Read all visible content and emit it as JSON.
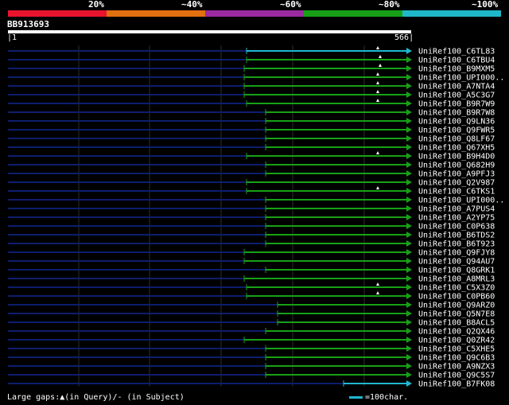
{
  "legend": {
    "segments": [
      {
        "color": "#e8142e",
        "label": "20%"
      },
      {
        "color": "#e07010",
        "label": "~40%"
      },
      {
        "color": "#9a2aa0",
        "label": "~60%"
      },
      {
        "color": "#17a017",
        "label": "~80%"
      },
      {
        "color": "#1fb8c8",
        "label": "~100%"
      }
    ]
  },
  "query": {
    "id": "BB913693",
    "start": "1",
    "end": "566",
    "length": 566
  },
  "hits": [
    {
      "label": "UniRef100_C6TL83",
      "start": 310,
      "color": "#1fb8d0",
      "gap": 475
    },
    {
      "label": "UniRef100_C6TBU4",
      "start": 310,
      "color": "#17a017",
      "gap": 478
    },
    {
      "label": "UniRef100_B9MXM5",
      "start": 307,
      "color": "#17a017",
      "gap": 478
    },
    {
      "label": "UniRef100_UPI000..",
      "start": 307,
      "color": "#17a017",
      "gap": 475
    },
    {
      "label": "UniRef100_A7NTA4",
      "start": 307,
      "color": "#17a017",
      "gap": 475
    },
    {
      "label": "UniRef100_A5C3G7",
      "start": 307,
      "color": "#17a017",
      "gap": 475
    },
    {
      "label": "UniRef100_B9R7W9",
      "start": 310,
      "color": "#17a017",
      "gap": 475
    },
    {
      "label": "UniRef100_B9R7W8",
      "start": 334,
      "color": "#17a017",
      "gap": null
    },
    {
      "label": "UniRef100_Q9LN36",
      "start": 334,
      "color": "#17a017",
      "gap": null
    },
    {
      "label": "UniRef100_Q9FWR5",
      "start": 334,
      "color": "#17a017",
      "gap": null
    },
    {
      "label": "UniRef100_Q8LF67",
      "start": 334,
      "color": "#17a017",
      "gap": null
    },
    {
      "label": "UniRef100_Q67XH5",
      "start": 334,
      "color": "#17a017",
      "gap": null
    },
    {
      "label": "UniRef100_B9H4D0",
      "start": 310,
      "color": "#17a017",
      "gap": 475
    },
    {
      "label": "UniRef100_Q682H9",
      "start": 334,
      "color": "#17a017",
      "gap": null
    },
    {
      "label": "UniRef100_A9PFJ3",
      "start": 334,
      "color": "#17a017",
      "gap": null
    },
    {
      "label": "UniRef100_Q2V987",
      "start": 310,
      "color": "#17a017",
      "gap": null
    },
    {
      "label": "UniRef100_C6TKS1",
      "start": 310,
      "color": "#17a017",
      "gap": 475
    },
    {
      "label": "UniRef100_UPI000..",
      "start": 334,
      "color": "#17a017",
      "gap": null
    },
    {
      "label": "UniRef100_A7PUS4",
      "start": 334,
      "color": "#17a017",
      "gap": null
    },
    {
      "label": "UniRef100_A2YP75",
      "start": 334,
      "color": "#17a017",
      "gap": null
    },
    {
      "label": "UniRef100_C0P638",
      "start": 334,
      "color": "#17a017",
      "gap": null
    },
    {
      "label": "UniRef100_B6TDS2",
      "start": 334,
      "color": "#17a017",
      "gap": null
    },
    {
      "label": "UniRef100_B6T923",
      "start": 334,
      "color": "#17a017",
      "gap": null
    },
    {
      "label": "UniRef100_Q9FJY8",
      "start": 307,
      "color": "#17a017",
      "gap": null
    },
    {
      "label": "UniRef100_Q94AU7",
      "start": 307,
      "color": "#17a017",
      "gap": null
    },
    {
      "label": "UniRef100_Q8GRK1",
      "start": 334,
      "color": "#17a017",
      "gap": null
    },
    {
      "label": "UniRef100_A8MRL3",
      "start": 307,
      "color": "#17a017",
      "gap": null
    },
    {
      "label": "UniRef100_C5X3Z0",
      "start": 310,
      "color": "#17a017",
      "gap": 475
    },
    {
      "label": "UniRef100_C0PB60",
      "start": 310,
      "color": "#17a017",
      "gap": 475
    },
    {
      "label": "UniRef100_Q9ARZ0",
      "start": 349,
      "color": "#17a017",
      "gap": null
    },
    {
      "label": "UniRef100_Q5N7E8",
      "start": 349,
      "color": "#17a017",
      "gap": null
    },
    {
      "label": "UniRef100_B8ACL5",
      "start": 349,
      "color": "#17a017",
      "gap": null
    },
    {
      "label": "UniRef100_Q2QX46",
      "start": 334,
      "color": "#17a017",
      "gap": null
    },
    {
      "label": "UniRef100_Q0ZR42",
      "start": 307,
      "color": "#17a017",
      "gap": null
    },
    {
      "label": "UniRef100_C5XHE5",
      "start": 334,
      "color": "#17a017",
      "gap": null
    },
    {
      "label": "UniRef100_Q9C6B3",
      "start": 334,
      "color": "#17a017",
      "gap": null
    },
    {
      "label": "UniRef100_A9NZX3",
      "start": 334,
      "color": "#17a017",
      "gap": null
    },
    {
      "label": "UniRef100_Q9C5S7",
      "start": 334,
      "color": "#17a017",
      "gap": null
    },
    {
      "label": "UniRef100_B7FK08",
      "start": 432,
      "color": "#1fb8d0",
      "gap": null
    }
  ],
  "footer": {
    "gaps_text": "Large gaps:▲(in Query)/- (in Subject)",
    "scale_text": "=100char."
  },
  "colors": {
    "background": "#000000",
    "left_line": "#0d1e6e",
    "grid": "#2e2e2e"
  }
}
